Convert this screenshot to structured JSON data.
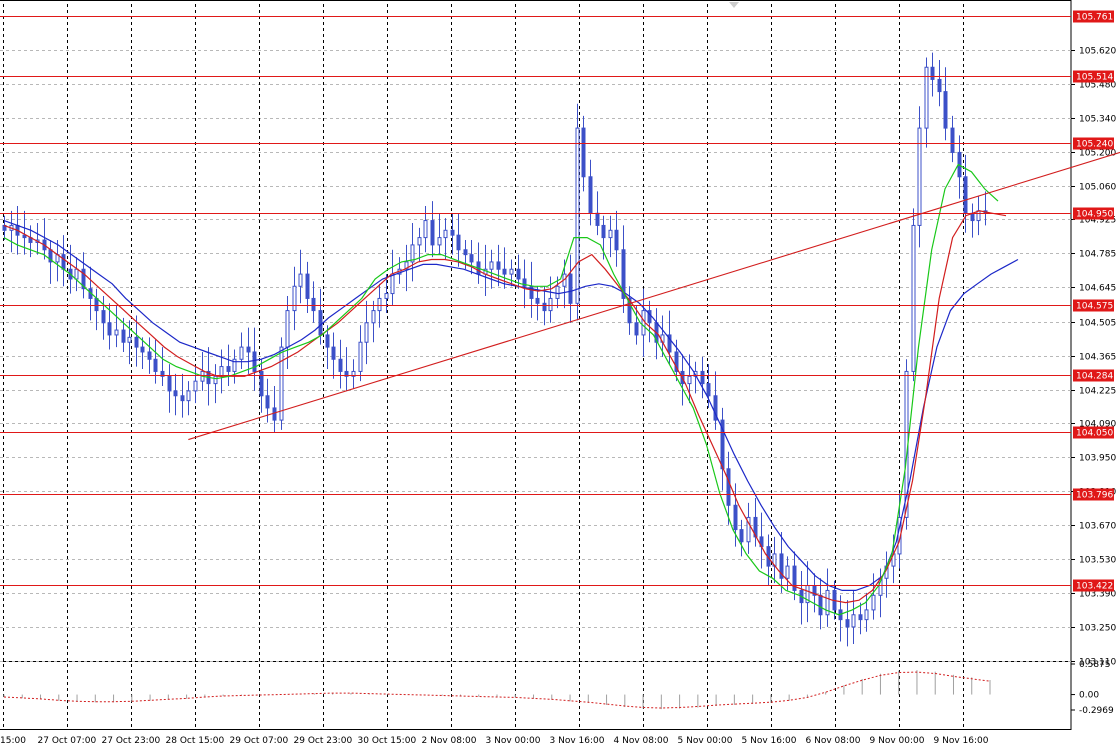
{
  "chart_data": {
    "type": "candlestick",
    "price_axis": {
      "ticks": [
        "105.620",
        "105.480",
        "105.340",
        "105.200",
        "105.060",
        "104.925",
        "104.785",
        "104.645",
        "104.505",
        "104.365",
        "104.225",
        "104.090",
        "103.950",
        "103.810",
        "103.670",
        "103.530",
        "103.390",
        "103.250",
        "103.110"
      ],
      "range": [
        103.11,
        105.81
      ]
    },
    "time_axis": {
      "ticks": [
        "15:00",
        "27 Oct 07:00",
        "27 Oct 23:00",
        "28 Oct 15:00",
        "29 Oct 07:00",
        "29 Oct 23:00",
        "30 Oct 15:00",
        "2 Nov 08:00",
        "3 Nov 00:00",
        "3 Nov 16:00",
        "4 Nov 08:00",
        "5 Nov 00:00",
        "5 Nov 16:00",
        "6 Nov 08:00",
        "9 Nov 00:00",
        "9 Nov 16:00"
      ]
    },
    "horizontal_levels": [
      "105.761",
      "105.514",
      "105.240",
      "104.950",
      "104.575",
      "104.284",
      "104.050",
      "103.796",
      "103.422"
    ],
    "trendline": {
      "from": {
        "bar": 28,
        "price": 104.02
      },
      "to": {
        "bar": 185,
        "price": 105.2
      }
    },
    "candles_close": [
      104.88,
      104.9,
      104.86,
      104.85,
      104.83,
      104.84,
      104.8,
      104.75,
      104.78,
      104.72,
      104.68,
      104.72,
      104.64,
      104.6,
      104.55,
      104.5,
      104.45,
      104.47,
      104.42,
      104.44,
      104.4,
      104.38,
      104.35,
      104.3,
      104.28,
      104.22,
      104.2,
      104.18,
      104.22,
      104.26,
      104.3,
      104.25,
      104.28,
      104.32,
      104.3,
      104.35,
      104.4,
      104.38,
      104.3,
      104.2,
      104.15,
      104.1,
      104.4,
      104.55,
      104.65,
      104.7,
      104.6,
      104.55,
      104.45,
      104.4,
      104.35,
      104.3,
      104.28,
      104.3,
      104.42,
      104.5,
      104.55,
      104.6,
      104.62,
      104.7,
      104.72,
      104.75,
      104.82,
      104.85,
      104.92,
      104.82,
      104.85,
      104.88,
      104.86,
      104.8,
      104.78,
      104.75,
      104.7,
      104.72,
      104.75,
      104.72,
      104.7,
      104.72,
      104.68,
      104.65,
      104.6,
      104.58,
      104.55,
      104.6,
      104.65,
      104.7,
      104.58,
      105.3,
      105.1,
      104.95,
      104.9,
      104.85,
      104.88,
      104.8,
      104.6,
      104.5,
      104.45,
      104.55,
      104.5,
      104.42,
      104.45,
      104.38,
      104.3,
      104.25,
      104.28,
      104.3,
      104.25,
      104.2,
      104.1,
      103.9,
      103.75,
      103.65,
      103.6,
      103.7,
      103.62,
      103.58,
      103.5,
      103.55,
      103.45,
      103.5,
      103.4,
      103.35,
      103.42,
      103.38,
      103.3,
      103.4,
      103.32,
      103.28,
      103.25,
      103.3,
      103.28,
      103.32,
      103.38,
      103.45,
      103.5,
      103.55,
      103.7,
      104.3,
      104.9,
      105.3,
      105.55,
      105.5,
      105.45,
      105.3,
      105.2,
      105.1,
      104.95,
      104.92,
      104.96,
      104.95
    ],
    "ma_green": [
      104.85,
      104.82,
      104.8,
      104.78,
      104.74,
      104.7,
      104.65,
      104.6,
      104.55,
      104.5,
      104.45,
      104.4,
      104.35,
      104.32,
      104.3,
      104.28,
      104.27,
      104.28,
      104.3,
      104.32,
      104.35,
      104.38,
      104.4,
      104.42,
      104.45,
      104.5,
      104.55,
      104.6,
      104.68,
      104.72,
      104.75,
      104.76,
      104.78,
      104.78,
      104.76,
      104.74,
      104.72,
      104.7,
      104.68,
      104.66,
      104.65,
      104.65,
      104.68,
      104.85,
      104.85,
      104.82,
      104.7,
      104.6,
      104.5,
      104.45,
      104.35,
      104.25,
      104.15,
      104.0,
      103.8,
      103.65,
      103.55,
      103.48,
      103.45,
      103.4,
      103.38,
      103.35,
      103.32,
      103.3,
      103.32,
      103.35,
      103.42,
      103.55,
      103.9,
      104.4,
      104.8,
      105.05,
      105.15,
      105.12,
      105.05,
      105.0
    ],
    "ma_red": [
      104.9,
      104.88,
      104.85,
      104.82,
      104.78,
      104.74,
      104.7,
      104.65,
      104.6,
      104.55,
      104.5,
      104.45,
      104.4,
      104.36,
      104.33,
      104.3,
      104.28,
      104.28,
      104.28,
      104.3,
      104.32,
      104.35,
      104.38,
      104.42,
      104.46,
      104.5,
      104.55,
      104.6,
      104.65,
      104.7,
      104.72,
      104.75,
      104.76,
      104.76,
      104.75,
      104.73,
      104.7,
      104.68,
      104.66,
      104.64,
      104.63,
      104.64,
      104.68,
      104.75,
      104.78,
      104.72,
      104.65,
      104.58,
      104.5,
      104.45,
      104.35,
      104.25,
      104.12,
      104.0,
      103.88,
      103.75,
      103.65,
      103.55,
      103.48,
      103.42,
      103.4,
      103.38,
      103.36,
      103.35,
      103.36,
      103.4,
      103.48,
      103.6,
      103.85,
      104.2,
      104.6,
      104.85,
      104.94,
      104.96,
      104.95,
      104.94
    ],
    "ma_blue": [
      104.92,
      104.9,
      104.88,
      104.85,
      104.82,
      104.78,
      104.74,
      104.7,
      104.66,
      104.6,
      104.55,
      104.5,
      104.46,
      104.42,
      104.4,
      104.38,
      104.36,
      104.34,
      104.34,
      104.35,
      104.37,
      104.4,
      104.43,
      104.47,
      104.52,
      104.56,
      104.6,
      104.64,
      104.68,
      104.7,
      104.72,
      104.74,
      104.74,
      104.73,
      104.72,
      104.7,
      104.68,
      104.66,
      104.65,
      104.64,
      104.63,
      104.62,
      104.63,
      104.65,
      104.66,
      104.65,
      104.62,
      104.58,
      104.52,
      104.45,
      104.38,
      104.3,
      104.2,
      104.08,
      103.96,
      103.85,
      103.75,
      103.66,
      103.58,
      103.52,
      103.46,
      103.42,
      103.4,
      103.4,
      103.42,
      103.46,
      103.6,
      103.85,
      104.15,
      104.4,
      104.55,
      104.62,
      104.66,
      104.7,
      104.73,
      104.76
    ],
    "oscillator": {
      "ticks": [
        "0.5875",
        "0.00",
        "-0.2969"
      ],
      "range": [
        -0.2969,
        0.5875
      ],
      "values": [
        -0.05,
        -0.07,
        -0.09,
        -0.12,
        -0.14,
        -0.15,
        -0.15,
        -0.14,
        -0.12,
        -0.1,
        -0.08,
        -0.05,
        -0.03,
        -0.02,
        -0.01,
        0.0,
        0.01,
        0.02,
        0.03,
        0.03,
        0.02,
        0.01,
        0.0,
        -0.01,
        -0.02,
        -0.03,
        -0.04,
        -0.05,
        -0.06,
        -0.08,
        -0.1,
        -0.13,
        -0.16,
        -0.2,
        -0.24,
        -0.27,
        -0.28,
        -0.27,
        -0.25,
        -0.22,
        -0.2,
        -0.18,
        -0.16,
        -0.12,
        -0.06,
        0.05,
        0.18,
        0.3,
        0.4,
        0.46,
        0.47,
        0.44,
        0.38,
        0.33,
        0.28
      ]
    }
  }
}
